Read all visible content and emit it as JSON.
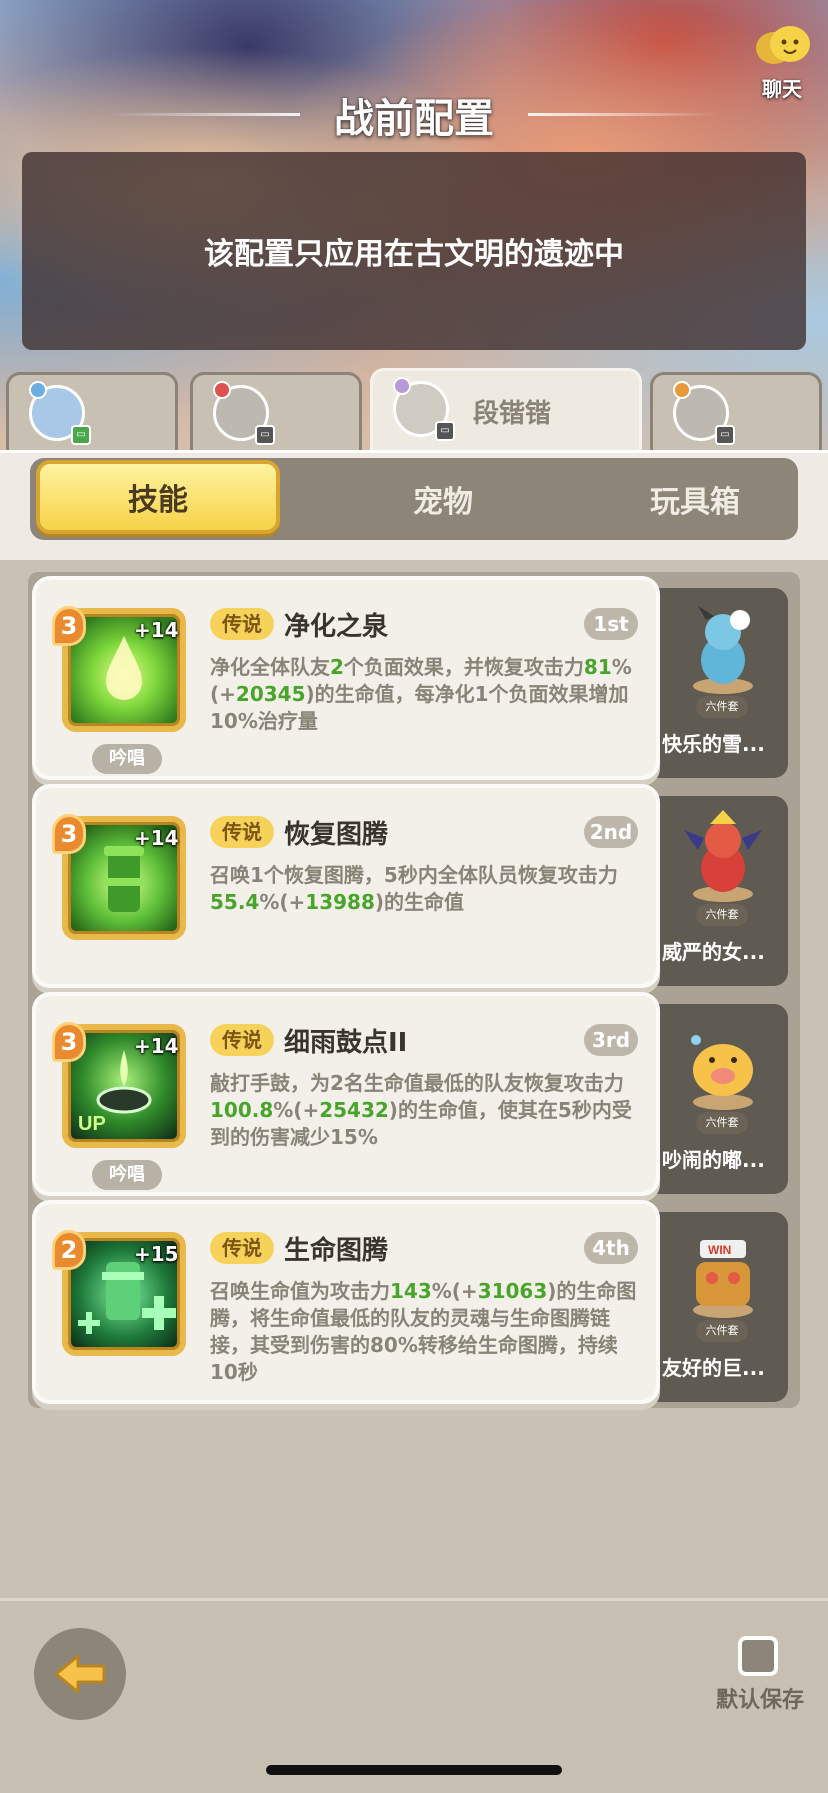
{
  "header": {
    "title": "战前配置",
    "chat_label": "聊天",
    "notice": "该配置只应用在古文明的遗迹中"
  },
  "characters": [
    {
      "name": "",
      "badge_color": "#6ab0e0"
    },
    {
      "name": "",
      "badge_color": "#e05050"
    },
    {
      "name": "段锴锴",
      "badge_color": "#b99ad9",
      "active": true
    },
    {
      "name": "",
      "badge_color": "#e89a3a"
    }
  ],
  "subtabs": {
    "skills": "技能",
    "pets": "宠物",
    "toys": "玩具箱",
    "active": "技能"
  },
  "skills": [
    {
      "level": "3",
      "plus": "+14",
      "rarity": "传说",
      "name": "净化之泉",
      "rank": "1st",
      "chant": "吟唱",
      "desc_parts": [
        "净化全体队友",
        "2",
        "个负面效果，并恢复攻击力",
        "81",
        "%(+",
        "20345",
        ")的生命值，每净化1个负面效果增加10%治疗量"
      ],
      "pet_name": "快乐的雪...",
      "pet_tag": "六件套"
    },
    {
      "level": "3",
      "plus": "+14",
      "rarity": "传说",
      "name": "恢复图腾",
      "rank": "2nd",
      "chant": "",
      "desc_parts": [
        "召唤1个恢复图腾，5秒内全体队员恢复攻击力",
        "55.4",
        "%(+",
        "13988",
        ")的生命值"
      ],
      "pet_name": "威严的女...",
      "pet_tag": "六件套"
    },
    {
      "level": "3",
      "plus": "+14",
      "rarity": "传说",
      "name": "细雨鼓点II",
      "rank": "3rd",
      "chant": "吟唱",
      "desc_parts": [
        "敲打手鼓，为2名生命值最低的队友恢复攻击力",
        "100.8",
        "%(+",
        "25432",
        ")的生命值，使其在5秒内受到的伤害减少15%"
      ],
      "pet_name": "吵闹的嘟...",
      "pet_tag": "六件套"
    },
    {
      "level": "2",
      "plus": "+15",
      "rarity": "传说",
      "name": "生命图腾",
      "rank": "4th",
      "chant": "",
      "desc_parts": [
        "召唤生命值为攻击力",
        "143",
        "%(+",
        "31063",
        ")的生命图腾，将生命值最低的队友的灵魂与生命图腾链接，其受到伤害的80%转移给生命图腾，持续10秒"
      ],
      "pet_name": "友好的巨...",
      "pet_tag": "六件套"
    }
  ],
  "footer": {
    "save_label": "默认保存"
  },
  "colors": {
    "accent_yellow": "#f6d248",
    "highlight_green": "#48a52a",
    "level_orange": "#e98a2e"
  }
}
